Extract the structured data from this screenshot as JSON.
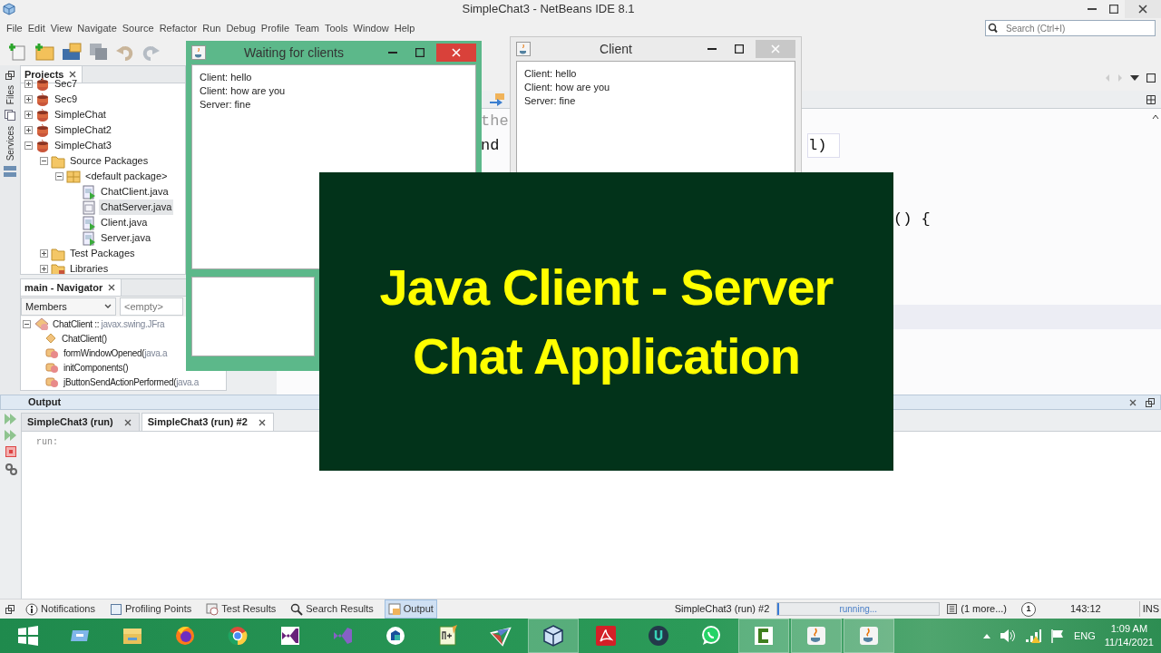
{
  "window": {
    "title": "SimpleChat3 - NetBeans IDE 8.1"
  },
  "menu": [
    "File",
    "Edit",
    "View",
    "Navigate",
    "Source",
    "Refactor",
    "Run",
    "Debug",
    "Profile",
    "Team",
    "Tools",
    "Window",
    "Help"
  ],
  "search": {
    "placeholder": "Search (Ctrl+I)"
  },
  "side_tabs": [
    "Files",
    "Services"
  ],
  "projects": {
    "title": "Projects",
    "tree": [
      {
        "label": "Sec7",
        "kind": "project",
        "expanded": false
      },
      {
        "label": "Sec9",
        "kind": "project",
        "expanded": false
      },
      {
        "label": "SimpleChat",
        "kind": "project",
        "expanded": false
      },
      {
        "label": "SimpleChat2",
        "kind": "project",
        "expanded": false
      },
      {
        "label": "SimpleChat3",
        "kind": "project",
        "expanded": true,
        "children": [
          {
            "label": "Source Packages",
            "kind": "folder",
            "expanded": true,
            "children": [
              {
                "label": "<default package>",
                "kind": "package",
                "expanded": true,
                "children": [
                  {
                    "label": "ChatClient.java",
                    "kind": "form",
                    "selected": false
                  },
                  {
                    "label": "ChatServer.java",
                    "kind": "class",
                    "selected": true
                  },
                  {
                    "label": "Client.java",
                    "kind": "form",
                    "selected": false
                  },
                  {
                    "label": "Server.java",
                    "kind": "form",
                    "selected": false
                  }
                ]
              }
            ]
          },
          {
            "label": "Test Packages",
            "kind": "folder",
            "expanded": false
          },
          {
            "label": "Libraries",
            "kind": "library",
            "expanded": false
          }
        ]
      }
    ]
  },
  "navigator": {
    "title": "main - Navigator",
    "filter": "Members",
    "placeholder": "<empty>",
    "root": {
      "label": "ChatClient ::",
      "detail": "javax.swing.JFra",
      "expanded": true
    },
    "members": [
      {
        "label": "ChatClient()",
        "kind": "constructor"
      },
      {
        "label": "formWindowOpened(",
        "detail": "java.a",
        "kind": "private"
      },
      {
        "label": "initComponents()",
        "kind": "private"
      },
      {
        "label": "jButtonSendActionPerformed(",
        "detail": "java.a",
        "kind": "private"
      }
    ]
  },
  "editor": {
    "fragments": [
      {
        "text": "the",
        "kind": "comment"
      },
      {
        "text": "nd",
        "kind": "code"
      },
      {
        "text": "l)",
        "kind": "matched"
      },
      {
        "text": "() {",
        "kind": "code"
      }
    ]
  },
  "output": {
    "title": "Output",
    "tabs": [
      {
        "label": "SimpleChat3 (run)",
        "selected": false
      },
      {
        "label": "SimpleChat3 (run) #2",
        "selected": true
      }
    ],
    "text": "run:"
  },
  "status_bar": {
    "items": [
      {
        "label": "Notifications",
        "kind": "info",
        "selected": false
      },
      {
        "label": "Profiling Points",
        "kind": "box",
        "selected": false
      },
      {
        "label": "Test Results",
        "kind": "clock",
        "selected": false
      },
      {
        "label": "Search Results",
        "kind": "search",
        "selected": false
      },
      {
        "label": "Output",
        "kind": "output",
        "selected": true
      }
    ],
    "task": "SimpleChat3 (run) #2",
    "progress": "running...",
    "level": 0.01,
    "more": "(1 more...)",
    "notifications": "1",
    "position": "143:12",
    "mode": "INS"
  },
  "server_window": {
    "title": "Waiting for clients",
    "active": true,
    "messages": [
      "Client: hello",
      "Client: how are you",
      "Server: fine"
    ]
  },
  "client_window": {
    "title": "Client",
    "active": false,
    "messages": [
      "Client: hello",
      "Client: how are you",
      "Server: fine"
    ]
  },
  "banner": {
    "lines": [
      "Java Client - Server",
      "Chat Application"
    ]
  },
  "taskbar": {
    "apps": [
      {
        "kind": "start",
        "open": false
      },
      {
        "kind": "desktop",
        "open": false
      },
      {
        "kind": "explorer",
        "open": false
      },
      {
        "kind": "firefox",
        "open": false
      },
      {
        "kind": "chrome",
        "open": false
      },
      {
        "kind": "vs",
        "open": false
      },
      {
        "kind": "vs2",
        "open": false
      },
      {
        "kind": "round",
        "open": false
      },
      {
        "kind": "notepad",
        "open": false
      },
      {
        "kind": "tri",
        "open": false
      },
      {
        "kind": "netbeans",
        "open": true
      },
      {
        "kind": "acrobat",
        "open": false
      },
      {
        "kind": "ucircle",
        "open": false
      },
      {
        "kind": "whatsapp",
        "open": false
      },
      {
        "kind": "camtasia",
        "open": true
      },
      {
        "kind": "java",
        "open": true
      },
      {
        "kind": "java",
        "open": true
      }
    ],
    "language": "ENG",
    "time": "1:09 AM",
    "date": "11/14/2021"
  }
}
